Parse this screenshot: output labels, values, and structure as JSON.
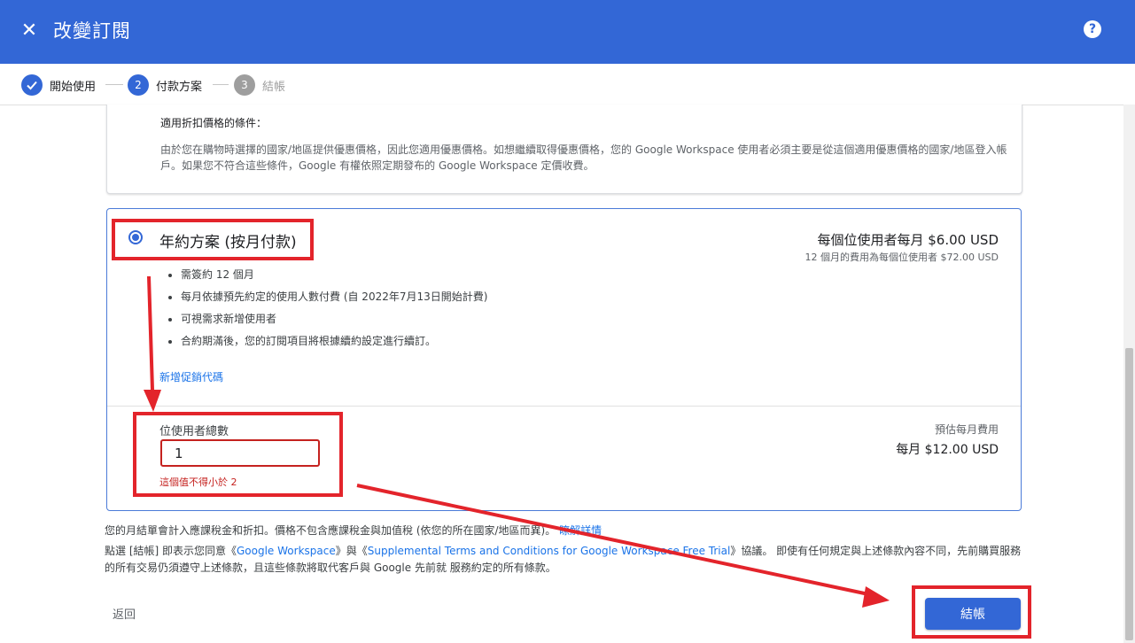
{
  "header": {
    "title": "改變訂閱",
    "close_icon": "close-icon",
    "help_glyph": "?"
  },
  "stepper": {
    "steps": [
      {
        "label": "開始使用",
        "number": "",
        "state": "done"
      },
      {
        "label": "付款方案",
        "number": "2",
        "state": "active"
      },
      {
        "label": "結帳",
        "number": "3",
        "state": "inactive"
      }
    ]
  },
  "conditions": {
    "title": "適用折扣價格的條件：",
    "text": "由於您在購物時選擇的國家/地區提供優惠價格，因此您適用優惠價格。如想繼續取得優惠價格，您的 Google Workspace 使用者必須主要是從這個適用優惠價格的國家/地區登入帳戶。如果您不符合這些條件，Google 有權依照定期發布的 Google Workspace 定價收費。"
  },
  "plan": {
    "name": "年約方案 (按月付款)",
    "selected": true,
    "price_main": "每個位使用者每月 $6.00 USD",
    "price_sub": "12 個月的費用為每個位使用者 $72.00 USD",
    "bullets": [
      "需簽約 12 個月",
      "每月依據預先約定的使用人數付費 (自 2022年7月13日開始計費)",
      "可視需求新增使用者",
      "合約期滿後，您的訂閱項目將根據續約設定進行續訂。"
    ],
    "promo_link": "新增促銷代碼",
    "seats_label": "位使用者總數",
    "seats_value": "1",
    "seats_error": "這個值不得小於 2",
    "estimate_label": "預估每月費用",
    "estimate_value": "每月 $12.00 USD"
  },
  "footer": {
    "tax_text": "您的月結單會計入應課稅金和折扣。價格不包含應課稅金與加值稅 (依您的所在國家/地區而異)。",
    "tax_link": "瞭解詳情",
    "terms_prefix": "點選 [結帳] 即表示您同意《",
    "terms_link1": "Google Workspace",
    "terms_mid": "》與《",
    "terms_link2": "Supplemental Terms and Conditions for Google Workspace Free Trial",
    "terms_suffix": "》協議。 即使有任何規定與上述條款內容不同，先前購買服務的所有交易仍須遵守上述條款，且這些條款將取代客戶與 Google 先前就 服務約定的所有條款。",
    "back_label": "返回",
    "checkout_label": "結帳"
  },
  "colors": {
    "header_bg": "#3367d6",
    "accent": "#3367d6",
    "error": "#c5221f",
    "annotation": "#e3242b"
  }
}
